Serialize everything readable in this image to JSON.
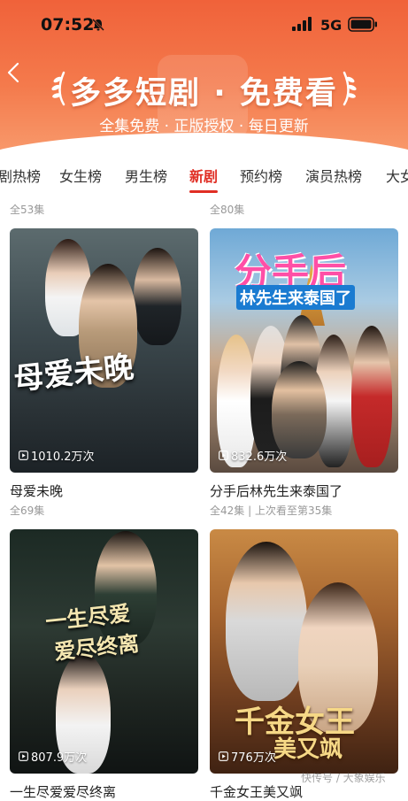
{
  "status_bar": {
    "time": "07:52",
    "network": "5G"
  },
  "header": {
    "title": "多多短剧 · 免费看",
    "subtitle": "全集免费 · 正版授权 · 每日更新"
  },
  "tabs": [
    {
      "label": "剧热榜"
    },
    {
      "label": "女生榜"
    },
    {
      "label": "男生榜"
    },
    {
      "label": "新剧",
      "active": true
    },
    {
      "label": "预约榜"
    },
    {
      "label": "演员热榜"
    },
    {
      "label": "大女"
    }
  ],
  "top_meta": [
    "全53集",
    "全80集"
  ],
  "dramas": [
    {
      "poster_text": "母爱未晚",
      "views": "1010.2万次",
      "title": "母爱未晚",
      "meta": "全69集"
    },
    {
      "poster_text": "分手后",
      "poster_text2": "林先生来泰国了",
      "views": "832.6万次",
      "title": "分手后林先生来泰国了",
      "meta": "全42集 | 上次看至第35集"
    },
    {
      "poster_text": "一生尽爱",
      "poster_text2": "爱尽终离",
      "views": "807.9万次",
      "title": "一生尽爱爱尽终离",
      "meta": ""
    },
    {
      "poster_text": "千金女王",
      "poster_text2": "美又飒",
      "views": "776万次",
      "title": "千金女王美又飒",
      "meta": ""
    }
  ],
  "watermark": "快传号 / 大象娱乐",
  "colors": {
    "accent": "#e02e24",
    "header": "#f0623a"
  }
}
